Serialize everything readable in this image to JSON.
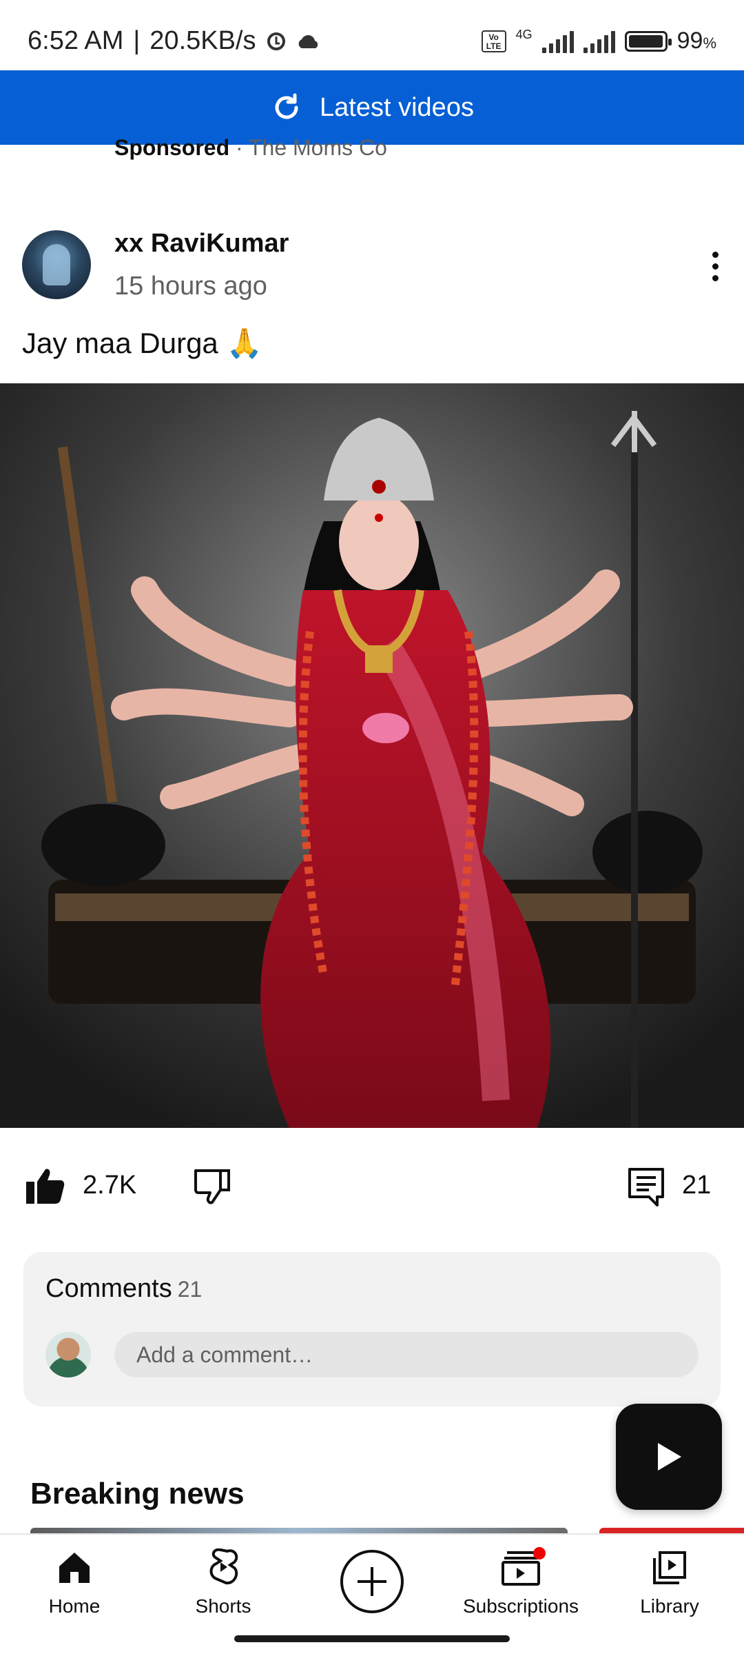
{
  "status_bar": {
    "time": "6:52 AM",
    "net_speed": "20.5KB/s",
    "network_type": "4G",
    "volte_badge": "Vo LTE",
    "battery": "99",
    "battery_unit": "%",
    "battery_level": 0.99
  },
  "banner": {
    "label": "Latest videos"
  },
  "sponsored": {
    "label": "Sponsored",
    "separator": "·",
    "advertiser": "The Moms Co"
  },
  "post": {
    "author": "xx RaviKumar",
    "time_ago": "15 hours ago",
    "text": "Jay maa Durga 🙏",
    "likes": "2.7K",
    "comments_count": "21"
  },
  "comments_box": {
    "title": "Comments",
    "count": "21",
    "placeholder": "Add a comment…"
  },
  "section": {
    "title": "Breaking news"
  },
  "bottom_nav": {
    "home": "Home",
    "shorts": "Shorts",
    "subscriptions": "Subscriptions",
    "library": "Library"
  },
  "icons": {
    "refresh": "refresh-icon",
    "more": "more-vert-icon",
    "like": "thumb-up-icon",
    "dislike": "thumb-down-icon",
    "comments": "comment-icon",
    "play": "play-icon",
    "create": "plus-circle-icon"
  },
  "colors": {
    "accent": "#065fd4",
    "notification": "#ee0000"
  }
}
